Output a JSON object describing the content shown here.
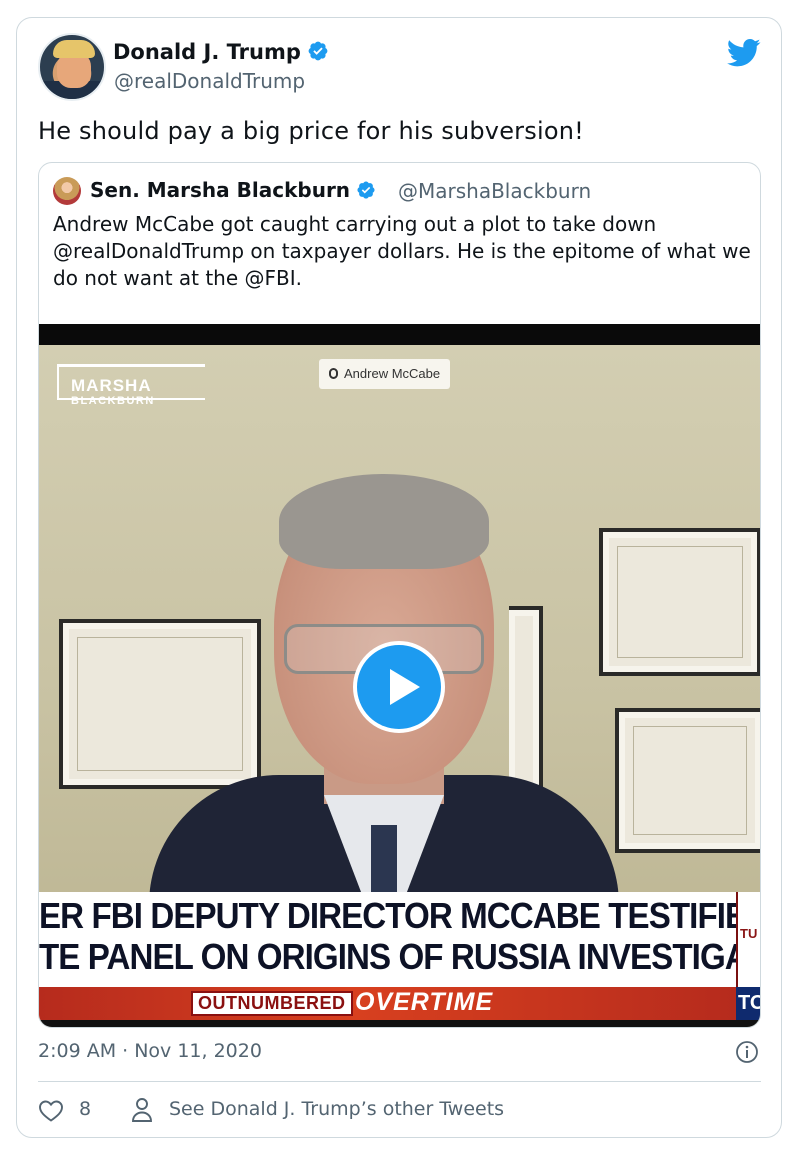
{
  "author": {
    "display_name": "Donald J. Trump",
    "handle": "@realDonaldTrump",
    "avatar_icon": "avatar-photo"
  },
  "tweet": {
    "text": "He should pay a big price for his subversion!"
  },
  "quoted_tweet": {
    "display_name": "Sen. Marsha Blackburn",
    "handle": "@MarshaBlackburn",
    "text": "Andrew McCabe got caught carrying out a plot to take down @realDonaldTrump on taxpayer dollars. He is the epitome of what we do not want at the @FBI."
  },
  "video": {
    "participant_label": "Andrew McCabe",
    "logo_line1": "MARSHA",
    "logo_line2": "BLACKBURN",
    "chyron_line1": "ER FBI DEPUTY DIRECTOR MCCABE TESTIFIES BEFORE",
    "chyron_line2": "TE PANEL ON ORIGINS OF RUSSIA INVESTIGATION",
    "show_name": "OUTNUMBERED",
    "show_suffix": "OVERTIME",
    "side_text_top": "TU",
    "side_text_bottom": "TO"
  },
  "footer": {
    "timestamp": "2:09 AM · Nov 11, 2020",
    "likes": "8",
    "other_tweets_link": "See Donald J. Trump’s other Tweets"
  },
  "colors": {
    "accent": "#1d9bf0",
    "secondary_text": "#536471",
    "border": "#cfd9de"
  }
}
